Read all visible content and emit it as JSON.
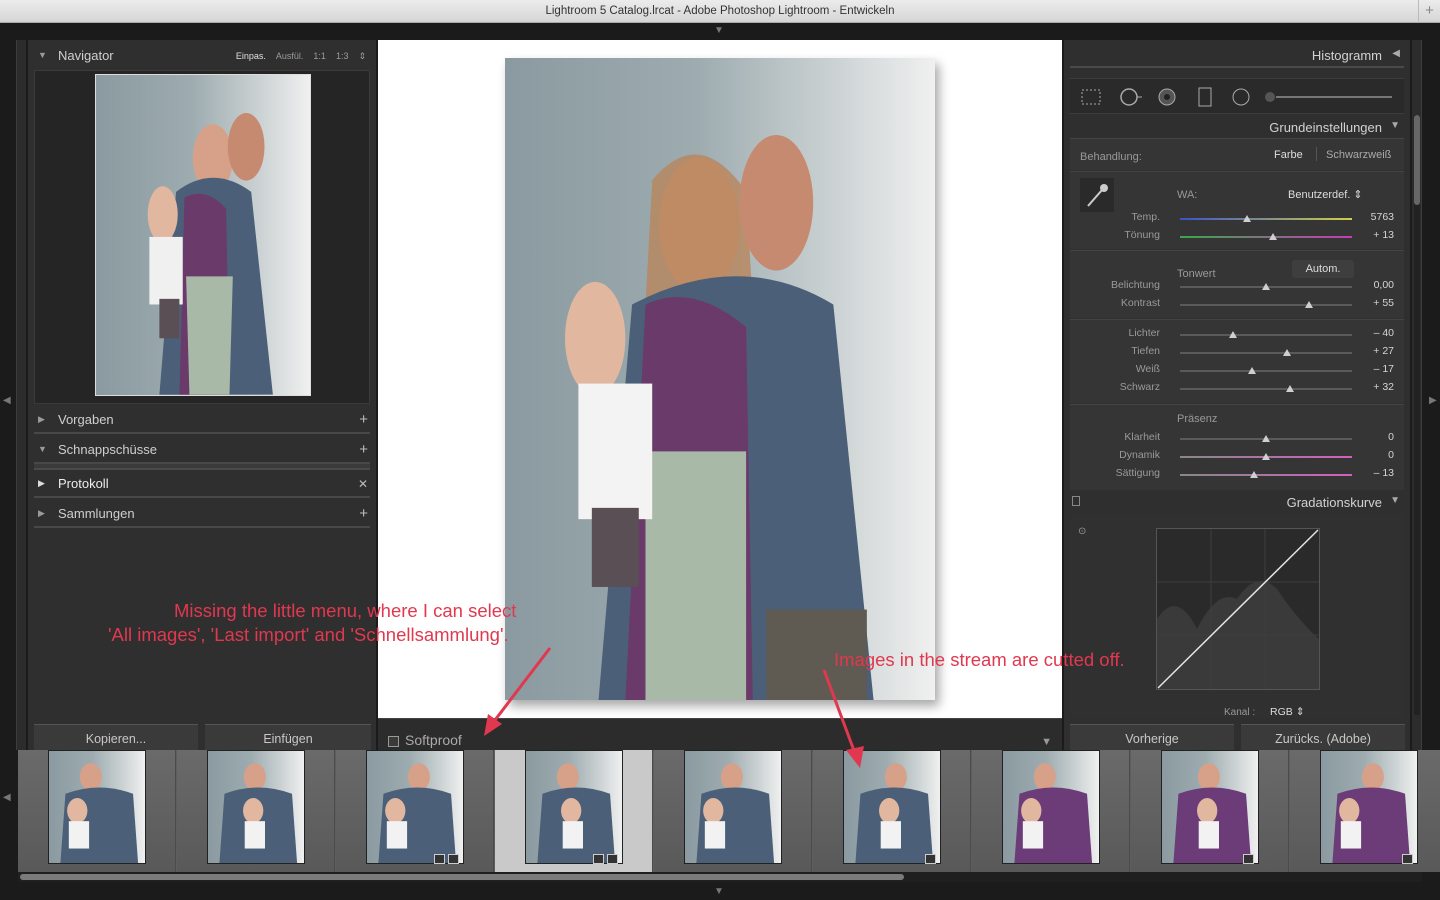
{
  "window": {
    "title": "Lightroom 5 Catalog.lrcat - Adobe Photoshop Lightroom - Entwickeln",
    "new_tab": "+"
  },
  "left_panel": {
    "navigator": {
      "label": "Navigator",
      "zoom": [
        "Einpas.",
        "Ausfül.",
        "1:1",
        "1:3"
      ],
      "zoom_stepper": "⇕"
    },
    "presets": {
      "label": "Vorgaben",
      "action": "+"
    },
    "snapshots": {
      "label": "Schnappschüsse",
      "action": "+"
    },
    "history": {
      "label": "Protokoll",
      "action": "✕"
    },
    "collections": {
      "label": "Sammlungen",
      "action": "+"
    },
    "copy_button": "Kopieren...",
    "paste_button": "Einfügen"
  },
  "toolbar": {
    "softproof_label": "Softproof",
    "menu_icon": "▼"
  },
  "right_panel": {
    "histogram": {
      "label": "Histogramm",
      "toggle": "◀"
    },
    "basic": {
      "label": "Grundeinstellungen",
      "toggle": "▼",
      "treatment_label": "Behandlung:",
      "treatment_color": "Farbe",
      "treatment_bw": "Schwarzweiß",
      "wb_label": "WA:",
      "wb_value": "Benutzerdef. ⇕",
      "tone_label": "Tonwert",
      "auto_button": "Autom.",
      "presence_label": "Präsenz",
      "sliders": [
        {
          "label": "Temp.",
          "value": "5763",
          "pos": 0.39
        },
        {
          "label": "Tönung",
          "value": "+ 13",
          "pos": 0.54
        },
        {
          "label": "Belichtung",
          "value": "0,00",
          "pos": 0.5
        },
        {
          "label": "Kontrast",
          "value": "+ 55",
          "pos": 0.75
        },
        {
          "label": "Lichter",
          "value": "– 40",
          "pos": 0.31
        },
        {
          "label": "Tiefen",
          "value": "+ 27",
          "pos": 0.62
        },
        {
          "label": "Weiß",
          "value": "– 17",
          "pos": 0.42
        },
        {
          "label": "Schwarz",
          "value": "+ 32",
          "pos": 0.64
        },
        {
          "label": "Klarheit",
          "value": "0",
          "pos": 0.5
        },
        {
          "label": "Dynamik",
          "value": "0",
          "pos": 0.5
        },
        {
          "label": "Sättigung",
          "value": "– 13",
          "pos": 0.43
        }
      ]
    },
    "tone_curve": {
      "label": "Gradationskurve",
      "toggle": "▼",
      "channel_label": "Kanal :",
      "channel_value": "RGB ⇕"
    },
    "previous_button": "Vorherige",
    "reset_button": "Zurücks. (Adobe)"
  },
  "filmstrip": {
    "selected_index": 3,
    "count": 9
  },
  "annotations": {
    "left_note_line1": "Missing the little menu, where I can select",
    "left_note_line2": "'All images', 'Last import' and 'Schnellsammlung'.",
    "right_note": "Images in the stream are cutted off."
  },
  "colors": {
    "annotation": "#e0384f",
    "panel_bg": "#2f2f2f"
  }
}
